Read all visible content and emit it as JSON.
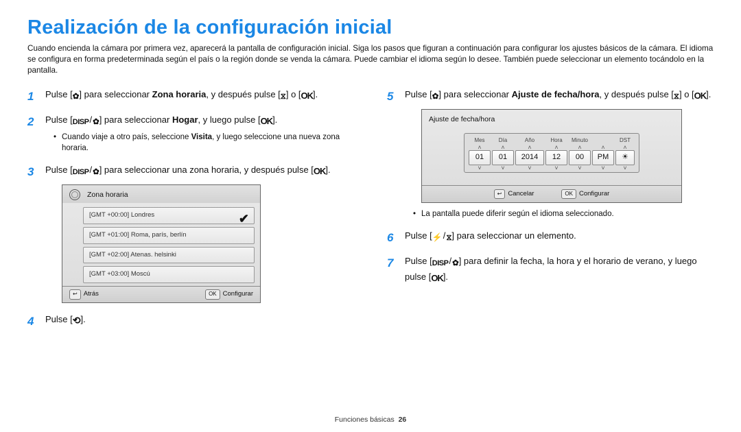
{
  "title": "Realización de la configuración inicial",
  "intro": "Cuando encienda la cámara por primera vez, aparecerá la pantalla de configuración inicial. Siga los pasos que figuran a continuación para configurar los ajustes básicos de la cámara. El idioma se configura en forma predeterminada según el país o la región donde se venda la cámara. Puede cambiar el idioma según lo desee. También puede seleccionar un elemento tocándolo en la pantalla.",
  "icons": {
    "ok": "OK",
    "disp": "DISP"
  },
  "steps_left": {
    "s1a": "Pulse [",
    "s1b": "] para seleccionar ",
    "s1bold": "Zona horaria",
    "s1c": ", y después pulse [",
    "s1d": "] o [",
    "s1e": "].",
    "s2a": "Pulse [",
    "s2b": "] para seleccionar ",
    "s2bold": "Hogar",
    "s2c": ", y luego pulse [",
    "s2d": "].",
    "s2sub": "Cuando viaje a otro país, seleccione ",
    "s2sub_b": "Visita",
    "s2sub2": ", y luego seleccione una nueva zona horaria.",
    "s3a": "Pulse [",
    "s3b": "] para seleccionar una zona horaria, y después pulse [",
    "s3c": "].",
    "s4a": "Pulse [",
    "s4b": "]."
  },
  "steps_right": {
    "s5a": "Pulse [",
    "s5b": "] para seleccionar ",
    "s5bold": "Ajuste de fecha/hora",
    "s5c": ", y después pulse [",
    "s5d": "] o [",
    "s5e": "].",
    "s5note": "La pantalla puede diferir según el idioma seleccionado.",
    "s6a": "Pulse [",
    "s6b": "] para seleccionar un elemento.",
    "s7a": "Pulse [",
    "s7b": "] para definir la fecha, la hora y el horario de verano, y luego pulse [",
    "s7c": "]."
  },
  "tz": {
    "title": "Zona horaria",
    "rows": [
      "[GMT +00:00] Londres",
      "[GMT +01:00] Roma, parís, berlín",
      "[GMT +02:00] Atenas. helsinki",
      "[GMT +03:00] Moscú"
    ],
    "back_btn": "↩",
    "back": "Atrás",
    "ok_btn": "OK",
    "ok": "Configurar",
    "check": "✔"
  },
  "dt": {
    "title": "Ajuste de fecha/hora",
    "labels": [
      "Mes",
      "Día",
      "Año",
      "Hora",
      "Minuto",
      "",
      "DST"
    ],
    "values": [
      "01",
      "01",
      "2014",
      "12",
      "00",
      "PM",
      "☀"
    ],
    "cancel_btn": "↩",
    "cancel": "Cancelar",
    "ok_btn": "OK",
    "ok": "Configurar"
  },
  "footer": {
    "section": "Funciones básicas",
    "page": "26"
  }
}
